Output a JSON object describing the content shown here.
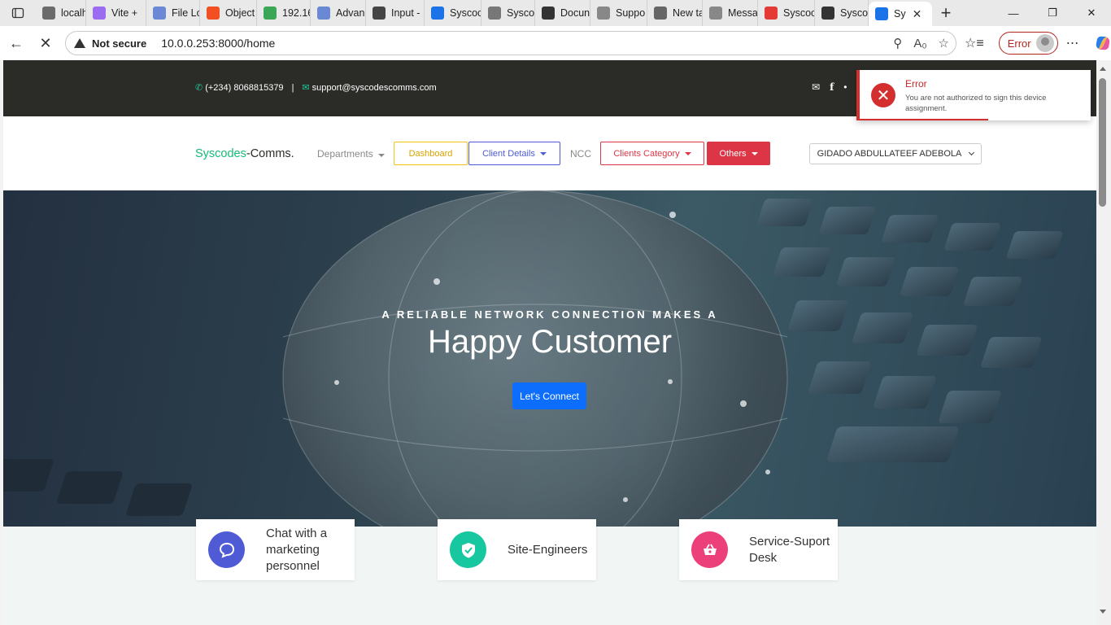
{
  "browser": {
    "tabs": [
      {
        "label": "localho",
        "color": "#6b6b6b"
      },
      {
        "label": "Vite +",
        "color": "#9b6cf0"
      },
      {
        "label": "File Lo",
        "color": "#6a88d4"
      },
      {
        "label": "Object",
        "color": "#f25022"
      },
      {
        "label": "192.16",
        "color": "#3aa757"
      },
      {
        "label": "Advan",
        "color": "#6a88d4"
      },
      {
        "label": "Input -",
        "color": "#444444"
      },
      {
        "label": "Syscoc",
        "color": "#1a73e8"
      },
      {
        "label": "Syscoc",
        "color": "#777777"
      },
      {
        "label": "Docun",
        "color": "#333333"
      },
      {
        "label": "Suppo",
        "color": "#888888"
      },
      {
        "label": "New ta",
        "color": "#666666"
      },
      {
        "label": "Messa",
        "color": "#888888"
      },
      {
        "label": "Syscoc",
        "color": "#e53935"
      },
      {
        "label": "Syscoc",
        "color": "#333333"
      },
      {
        "label": "Sy",
        "color": "#1a73e8"
      }
    ],
    "not_secure": "Not secure",
    "url": "10.0.0.253:8000/home",
    "profile_status": "Error"
  },
  "topbar": {
    "phone": "(+234) 8068815379",
    "separator": "|",
    "email": "support@syscodescomms.com"
  },
  "navbar": {
    "brand_part1": "Syscodes",
    "brand_part2": "-Comms.",
    "departments": "Departments",
    "dashboard": "Dashboard",
    "client_details": "Client Details",
    "ncc": "NCC",
    "clients_category": "Clients Category",
    "others": "Others",
    "user": "GIDADO ABDULLATEEF ADEBOLA"
  },
  "hero": {
    "subtitle": "A RELIABLE NETWORK CONNECTION MAKES A",
    "title": "Happy Customer",
    "cta": "Let's Connect"
  },
  "cards": [
    {
      "label": "Chat with a marketing personnel",
      "color": "#4f5bd5"
    },
    {
      "label": "Site-Engineers",
      "color": "#17c7a0"
    },
    {
      "label": "Service-Suport Desk",
      "color": "#ec407a"
    }
  ],
  "toast": {
    "title": "Error",
    "message": "You are not authorized to sign this device assignment."
  }
}
